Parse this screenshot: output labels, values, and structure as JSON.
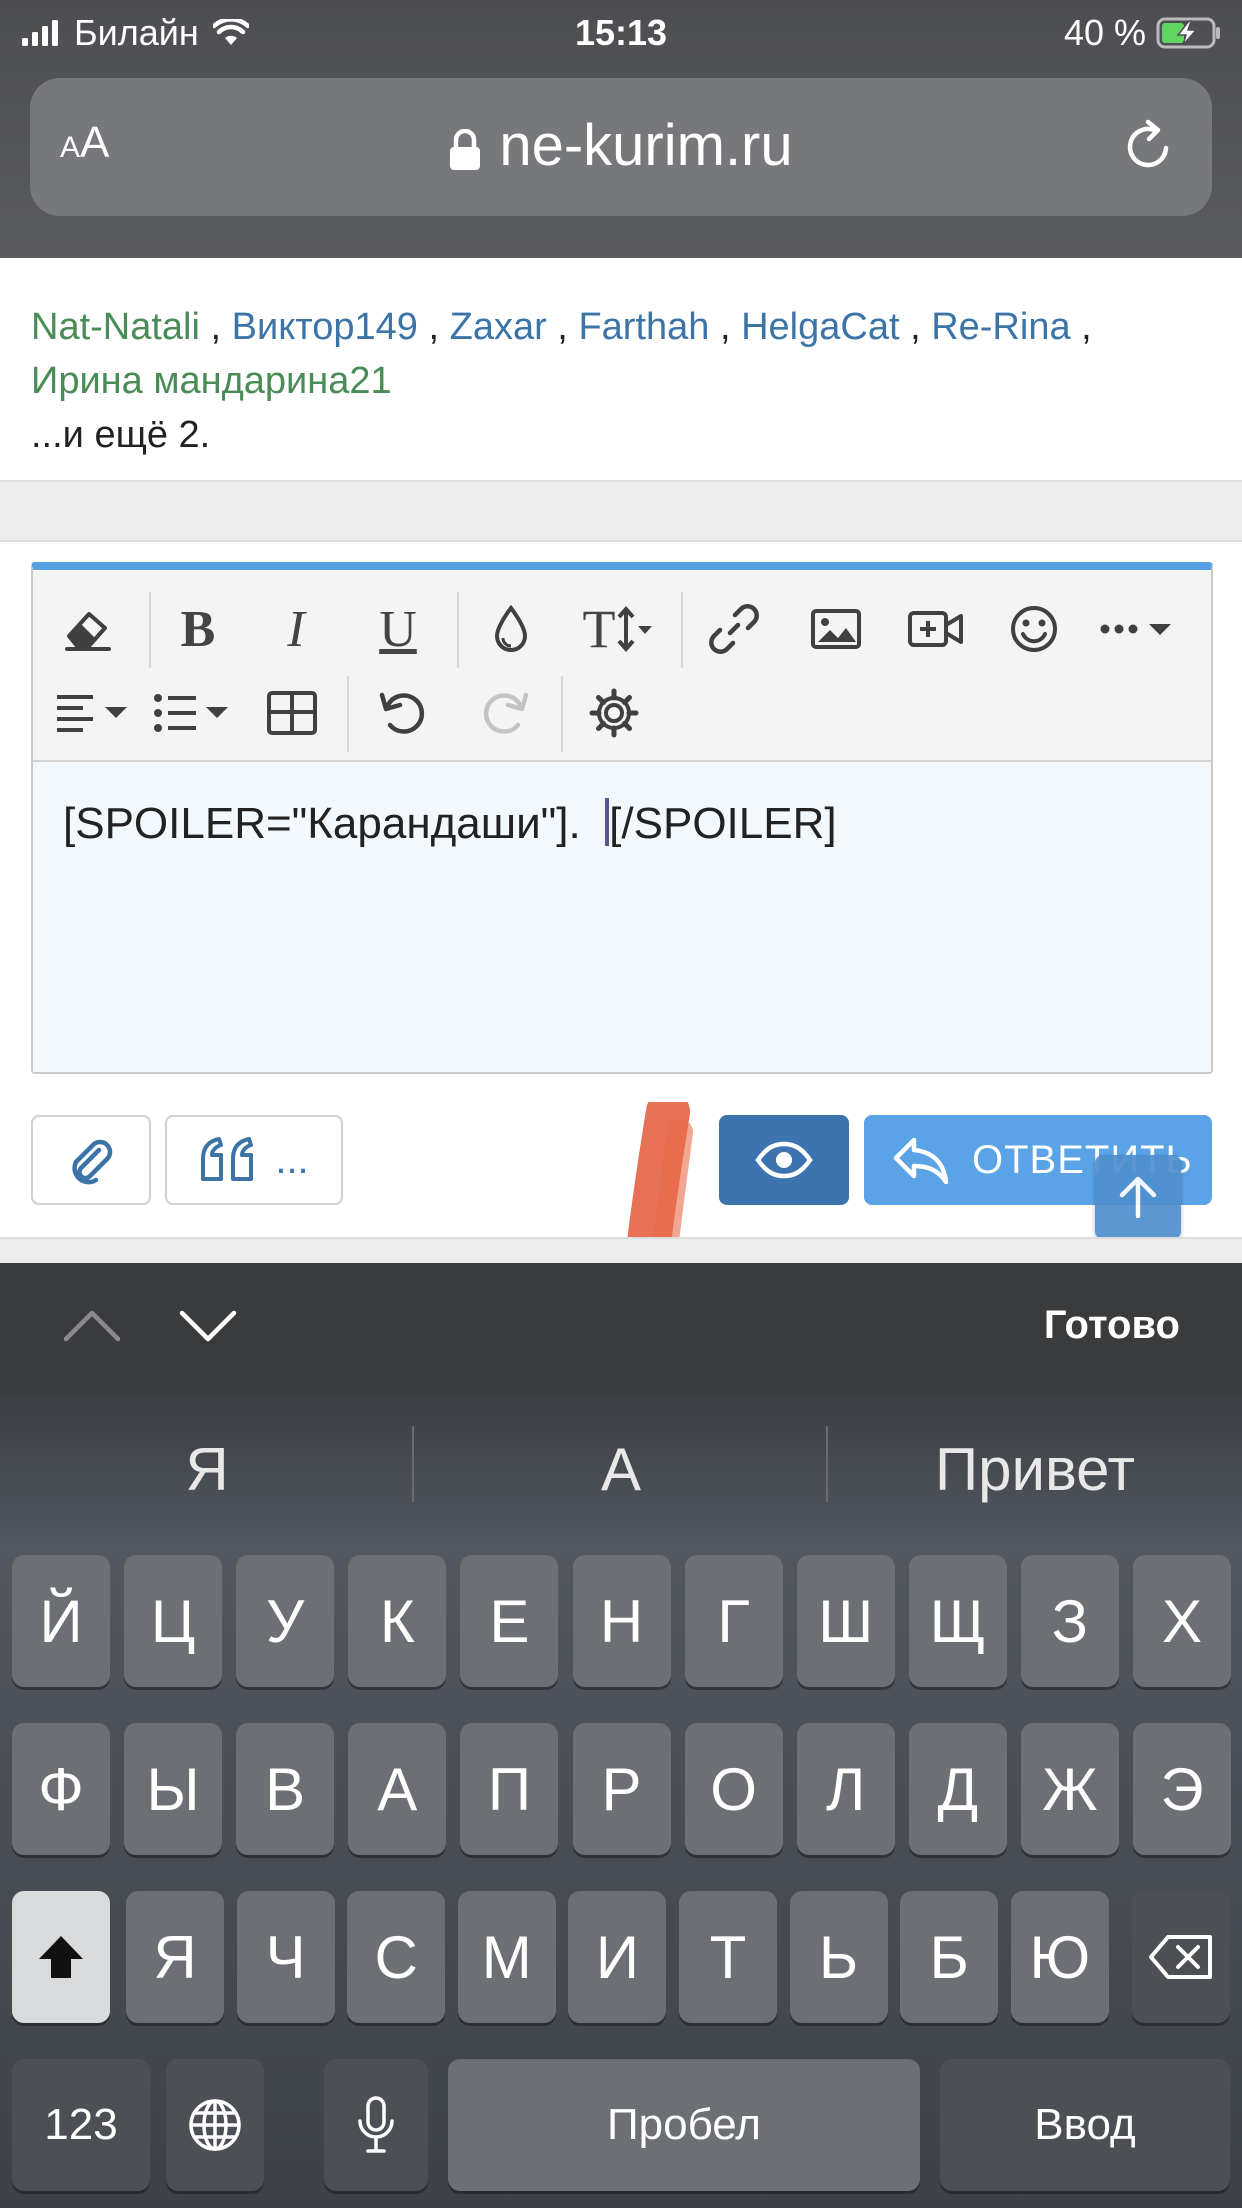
{
  "status_bar": {
    "carrier": "Билайн",
    "time": "15:13",
    "battery": "40 %"
  },
  "browser": {
    "text_size_big": "A",
    "text_size_small": "A",
    "domain": "ne-kurim.ru"
  },
  "likes": {
    "users": [
      {
        "name": "Nat-Natali",
        "color": "#4a8c57"
      },
      {
        "name": "Виктор149",
        "color": "#3d74a8"
      },
      {
        "name": "Zaxar",
        "color": "#3d74a8"
      },
      {
        "name": "Farthah",
        "color": "#3d74a8"
      },
      {
        "name": "HelgaCat",
        "color": "#3d74a8"
      },
      {
        "name": "Re-Rina",
        "color": "#3d74a8"
      },
      {
        "name": "Ирина мандарина21",
        "color": "#4a8c57"
      }
    ],
    "separator": " , ",
    "more": "...и ещё 2."
  },
  "editor": {
    "content_before_caret": "[SPOILER=\"Карандаши\"].  ",
    "content_after_caret": "[/SPOILER]",
    "toolbar_icons": [
      "eraser-icon",
      "bold-icon",
      "italic-icon",
      "underline-icon",
      "color-drop-icon",
      "font-size-icon",
      "link-icon",
      "image-icon",
      "video-icon",
      "smiley-icon",
      "more-icon",
      "align-icon",
      "list-icon",
      "table-icon",
      "undo-icon",
      "redo-icon",
      "settings-icon"
    ],
    "bold": "B",
    "italic": "I",
    "underline": "U",
    "textsize": "T",
    "more": "···"
  },
  "actions": {
    "quote_label": "...",
    "reply_label": "ОТВЕТИТЬ"
  },
  "keyboard": {
    "done": "Готово",
    "suggestions": [
      "Я",
      "А",
      "Привет"
    ],
    "row1": [
      "Й",
      "Ц",
      "У",
      "К",
      "Е",
      "Н",
      "Г",
      "Ш",
      "Щ",
      "З",
      "Х"
    ],
    "row2": [
      "Ф",
      "Ы",
      "В",
      "А",
      "П",
      "Р",
      "О",
      "Л",
      "Д",
      "Ж",
      "Э"
    ],
    "row3": [
      "Я",
      "Ч",
      "С",
      "М",
      "И",
      "Т",
      "Ь",
      "Б",
      "Ю"
    ],
    "numbers": "123",
    "space": "Пробел",
    "enter": "Ввод"
  }
}
